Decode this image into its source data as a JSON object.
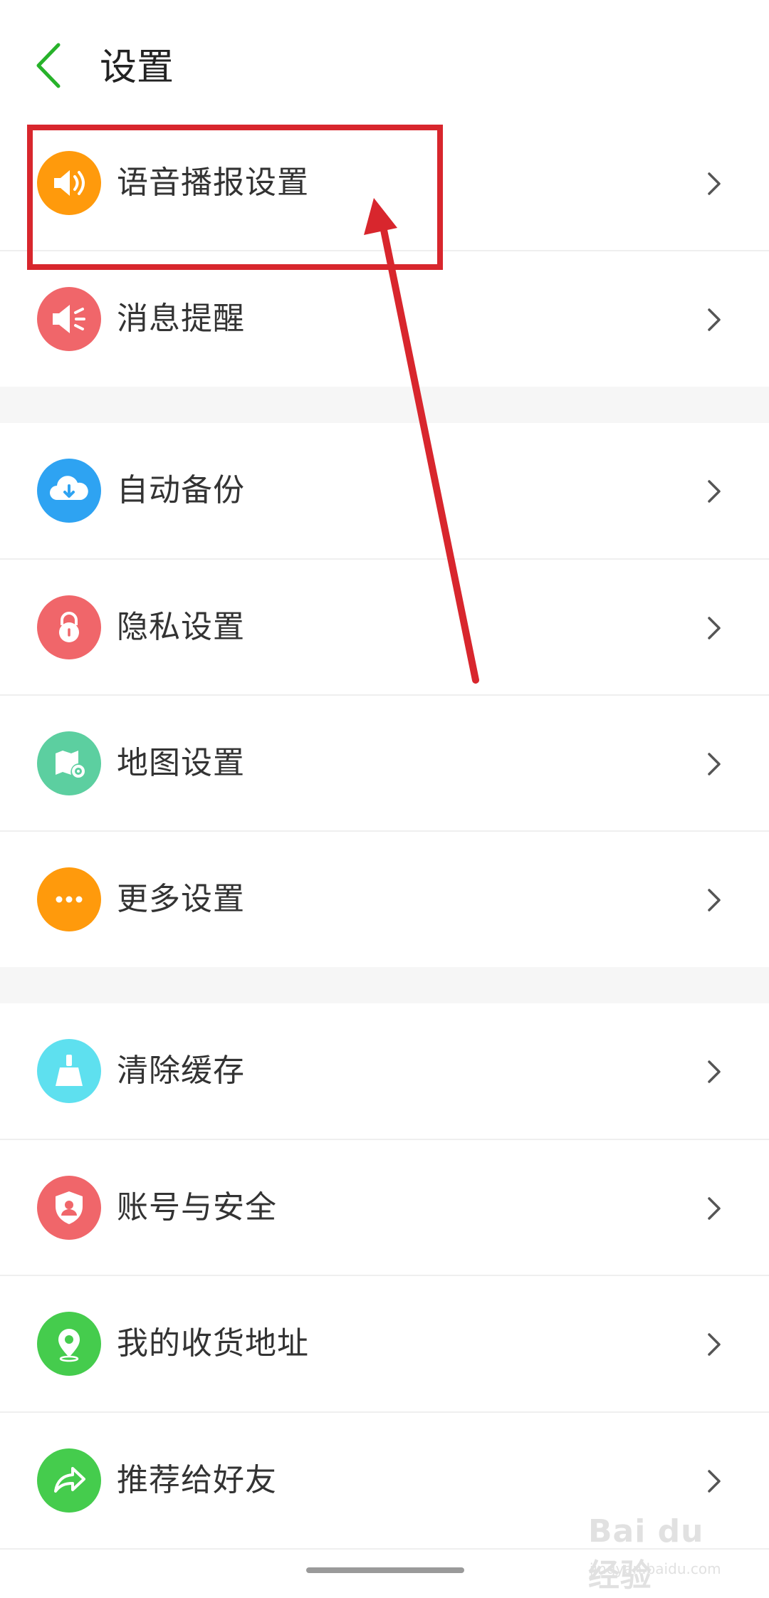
{
  "header": {
    "title": "设置",
    "back_icon": "chevron-left-icon",
    "accent_color": "#27b22a"
  },
  "groups": [
    {
      "items": [
        {
          "label": "语音播报设置",
          "icon": "speaker-icon",
          "color": "#ff9a0c"
        },
        {
          "label": "消息提醒",
          "icon": "megaphone-icon",
          "color": "#f0666a"
        }
      ]
    },
    {
      "items": [
        {
          "label": "自动备份",
          "icon": "cloud-download-icon",
          "color": "#2ea3f2"
        },
        {
          "label": "隐私设置",
          "icon": "lock-icon",
          "color": "#f0666a"
        },
        {
          "label": "地图设置",
          "icon": "map-gear-icon",
          "color": "#5ccfa0"
        },
        {
          "label": "更多设置",
          "icon": "more-dots-icon",
          "color": "#ff9a0c"
        }
      ]
    },
    {
      "items": [
        {
          "label": "清除缓存",
          "icon": "broom-icon",
          "color": "#5ee0ef"
        },
        {
          "label": "账号与安全",
          "icon": "shield-user-icon",
          "color": "#f0666a"
        },
        {
          "label": "我的收货地址",
          "icon": "location-pin-icon",
          "color": "#45cc4d"
        },
        {
          "label": "推荐给好友",
          "icon": "share-arrow-icon",
          "color": "#45cc4d"
        }
      ]
    }
  ],
  "annotation": {
    "color": "#d8262d"
  },
  "watermark": {
    "main": "Bai du 经验",
    "sub": "jingyan.baidu.com"
  }
}
